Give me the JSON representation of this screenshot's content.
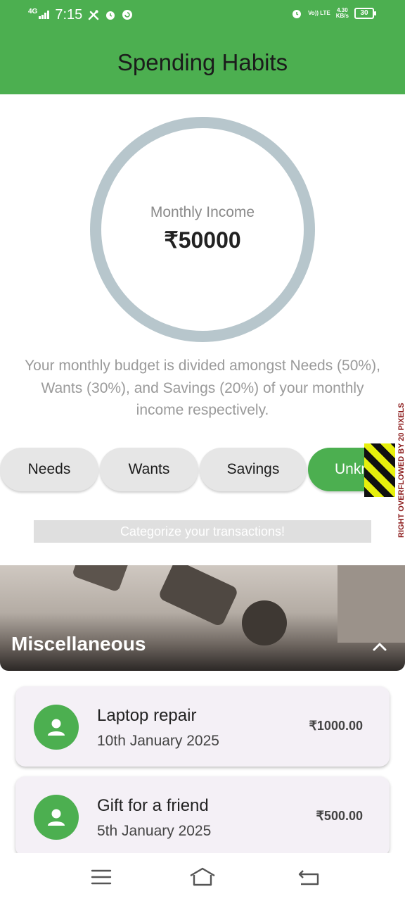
{
  "status_bar": {
    "network": "4G",
    "time": "7:15",
    "volte": "Vo)) LTE",
    "speed": "4.30",
    "speed_unit": "KB/s",
    "battery": "30"
  },
  "app_bar": {
    "title": "Spending Habits"
  },
  "income": {
    "label": "Monthly Income",
    "value": "₹50000"
  },
  "budget_description": "Your monthly budget is divided amongst Needs (50%), Wants (30%), and Savings (20%) of your monthly income respectively.",
  "categories": [
    {
      "label": "Needs",
      "selected": false
    },
    {
      "label": "Wants",
      "selected": false
    },
    {
      "label": "Savings",
      "selected": false
    },
    {
      "label": "Unknown",
      "selected": true
    }
  ],
  "overflow_warning": "RIGHT OVERFLOWED BY 20 PIXELS",
  "categorize_prompt": "Categorize your transactions!",
  "section": {
    "title": "Miscellaneous",
    "expanded": true
  },
  "transactions": [
    {
      "name": "Laptop repair",
      "date": "10th January 2025",
      "amount": "₹1000.00",
      "icon": "person-icon"
    },
    {
      "name": "Gift for a friend",
      "date": "5th January 2025",
      "amount": "₹500.00",
      "icon": "person-icon"
    }
  ],
  "colors": {
    "primary": "#4caf50",
    "ring": "#b7c6cc",
    "chip": "#e6e6e6",
    "card": "#f4f0f6"
  }
}
